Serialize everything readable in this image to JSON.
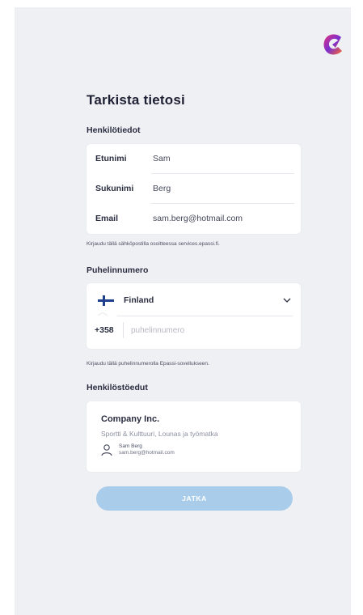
{
  "header": {
    "logo_icon": "brand-logo-icon",
    "title": "Tarkista tietosi"
  },
  "personal": {
    "heading": "Henkilötiedot",
    "rows": [
      {
        "label": "Etunimi",
        "value": "Sam"
      },
      {
        "label": "Sukunimi",
        "value": "Berg"
      },
      {
        "label": "Email",
        "value": "sam.berg@hotmail.com"
      }
    ],
    "hint": "Kirjaudu tällä sähköpostilla osoitteessa services.epassi.fi."
  },
  "phone": {
    "heading": "Puhelinnumero",
    "country": "Finland",
    "country_flag_icon": "finland-flag-icon",
    "prefix": "+358",
    "value": "",
    "placeholder": "puhelinnumero",
    "hint": "Kirjaudu tällä puhelinnumerolla Epassi-sovellukseen."
  },
  "benefits": {
    "heading": "Henkilöstöedut",
    "company": "Company Inc.",
    "benefit_list": "Sportti & Kulttuuri, Lounas ja työmatka",
    "person_name": "Sam Berg",
    "person_email": "sam.berg@hotmail.com"
  },
  "actions": {
    "continue_label": "JATKA"
  },
  "colors": {
    "background": "#eff0f4",
    "card": "#ffffff",
    "button_disabled": "#a9cceb",
    "flag_blue": "#1f3f8f"
  }
}
